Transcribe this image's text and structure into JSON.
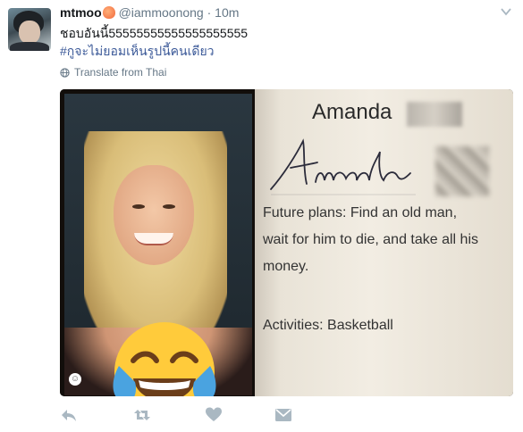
{
  "tweet": {
    "display_name": "mtmoo",
    "handle": "@iammoonong",
    "separator": "·",
    "time": "10m",
    "text_line1": "ชอบอันนี้55555555555555555555",
    "hashtag": "#กูจะไม่ยอมเห็นรูปนี้คนเดียว",
    "translate_label": "Translate from Thai"
  },
  "media": {
    "name_heading": "Amanda",
    "signature_text": "Amanda",
    "line1": "Future plans: Find an old man,",
    "line2": "wait for him to die, and take all his",
    "line3": "money.",
    "line4": "Activities: Basketball",
    "emoji_icon": "face-with-tears-of-joy"
  },
  "actions": {
    "icons": [
      "reply-icon",
      "retweet-icon",
      "like-icon",
      "message-icon"
    ]
  },
  "colors": {
    "text": "#14171a",
    "muted": "#657786",
    "hashtag": "#3b5998",
    "icon": "#aab8c2"
  }
}
